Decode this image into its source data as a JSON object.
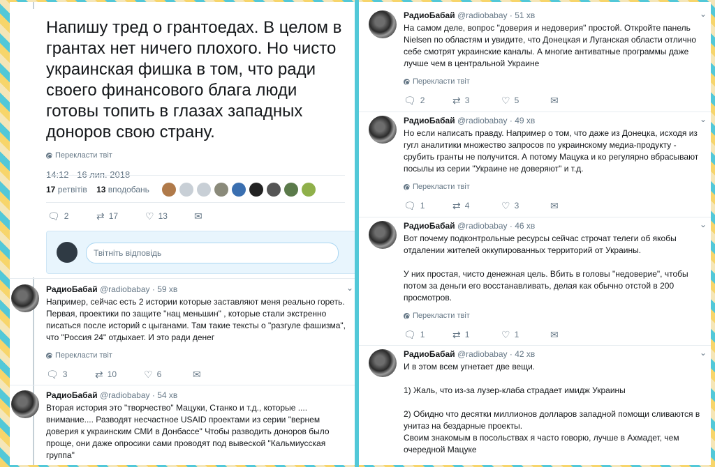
{
  "main_tweet": {
    "text": "Напишу тред о грантоедах. В целом в грантах нет ничего плохого. Но чисто украинская фишка в том, что ради своего финансового блага люди готовы топить в глазах западных доноров свою страну.",
    "translate": "Перекласти твіт",
    "timestamp": "14:12 - 16 лип. 2018",
    "retweets_count": "17",
    "retweets_label": "ретвітів",
    "likes_count": "13",
    "likes_label": "вподобань",
    "actions": {
      "replies": "2",
      "retweets": "17",
      "likes": "13"
    }
  },
  "reply_box": {
    "placeholder": "Твітніть відповідь"
  },
  "left_tweets": [
    {
      "name": "РадиоБабай",
      "handle": "@radiobabay",
      "time": "· 59 хв",
      "lines": [
        "Например, сейчас есть 2 истории которые заставляют меня реально гореть.",
        "Первая, проектики по защите \"нац меньшин\" , которые стали экстренно",
        "писаться после историй с цыганами.  Там такие тексты о \"разгуле фашизма\",",
        "что \"Россия 24\" отдыхает. И это ради денег"
      ],
      "translate": "Перекласти твіт",
      "replies": "3",
      "retweets": "10",
      "likes": "6"
    },
    {
      "name": "РадиоБабай",
      "handle": "@radiobabay",
      "time": "· 54 хв",
      "lines": [
        "Вторая история это \"творчество\" Мацуки, Станко и т.д., которые ....",
        "внимание.... Разводят несчастное USAID проектами из серии \"вернем",
        "доверия к украинским СМИ в Донбассе\"  Чтобы разводить доноров было",
        "проще, они даже опросики сами проводят под вывеской \"Кальмиусская",
        "группа\""
      ]
    }
  ],
  "right_tweets": [
    {
      "name": "РадиоБабай",
      "handle": "@radiobabay",
      "time": "· 51 хв",
      "lines": [
        "На самом деле, вопрос \"доверия и недоверия\" простой. Откройте панель",
        "Nielsen по областям и увидите, что Донецкая и Луганская области отлично",
        "себе смотрят украинские каналы. А многие антиватные программы даже",
        "лучше чем в центральной Украине"
      ],
      "translate": "Перекласти твіт",
      "replies": "2",
      "retweets": "3",
      "likes": "5"
    },
    {
      "name": "РадиоБабай",
      "handle": "@radiobabay",
      "time": "· 49 хв",
      "lines": [
        "Но если написать правду. Например о том, что даже из Донецка, исходя из",
        "гугл аналитики множество запросов по украинскому медиа-продукту -",
        "срубить гранты не получится. А потому Мацука и ко регулярно вбрасывают",
        "посылы из серии \"Украине не доверяют\" и т.д."
      ],
      "translate": "Перекласти твіт",
      "replies": "1",
      "retweets": "4",
      "likes": "3"
    },
    {
      "name": "РадиоБабай",
      "handle": "@radiobabay",
      "time": "· 46 хв",
      "lines": [
        "Вот почему подконтрольные  ресурсы сейчас строчат телеги об якобы",
        "отдалении жителей оккупированных территорий от Украины.",
        "",
        "У них простая, чисто денежная цель. Вбить в головы \"недоверие\", чтобы",
        "потом за деньги его восстанавливать, делая как обычно отстой в 200",
        "просмотров."
      ],
      "translate": "Перекласти твіт",
      "replies": "1",
      "retweets": "1",
      "likes": "1"
    },
    {
      "name": "РадиоБабай",
      "handle": "@radiobabay",
      "time": "· 42 хв",
      "lines": [
        "И в этом всем угнетает две вещи.",
        "",
        "1) Жаль, что из-за лузер-клаба страдает имидж Украины",
        "",
        "2) Обидно что десятки  миллионов долларов  западной помощи сливаются в",
        "унитаз на бездарные проекты.",
        "Своим знакомым в посольствах я часто говорю, лучше в Ахмадет, чем",
        "очередной  Мацуке"
      ]
    }
  ],
  "icons": {
    "reply": "reply-icon",
    "retweet": "retweet-icon",
    "like": "heart-icon",
    "dm": "envelope-icon",
    "translate": "globe-icon",
    "menu": "chevron-down-icon"
  },
  "colors": {
    "accent": "#1da1f2",
    "muted": "#657786",
    "frame_cyan": "#52c8d8",
    "frame_yellow": "#f7d56b"
  }
}
